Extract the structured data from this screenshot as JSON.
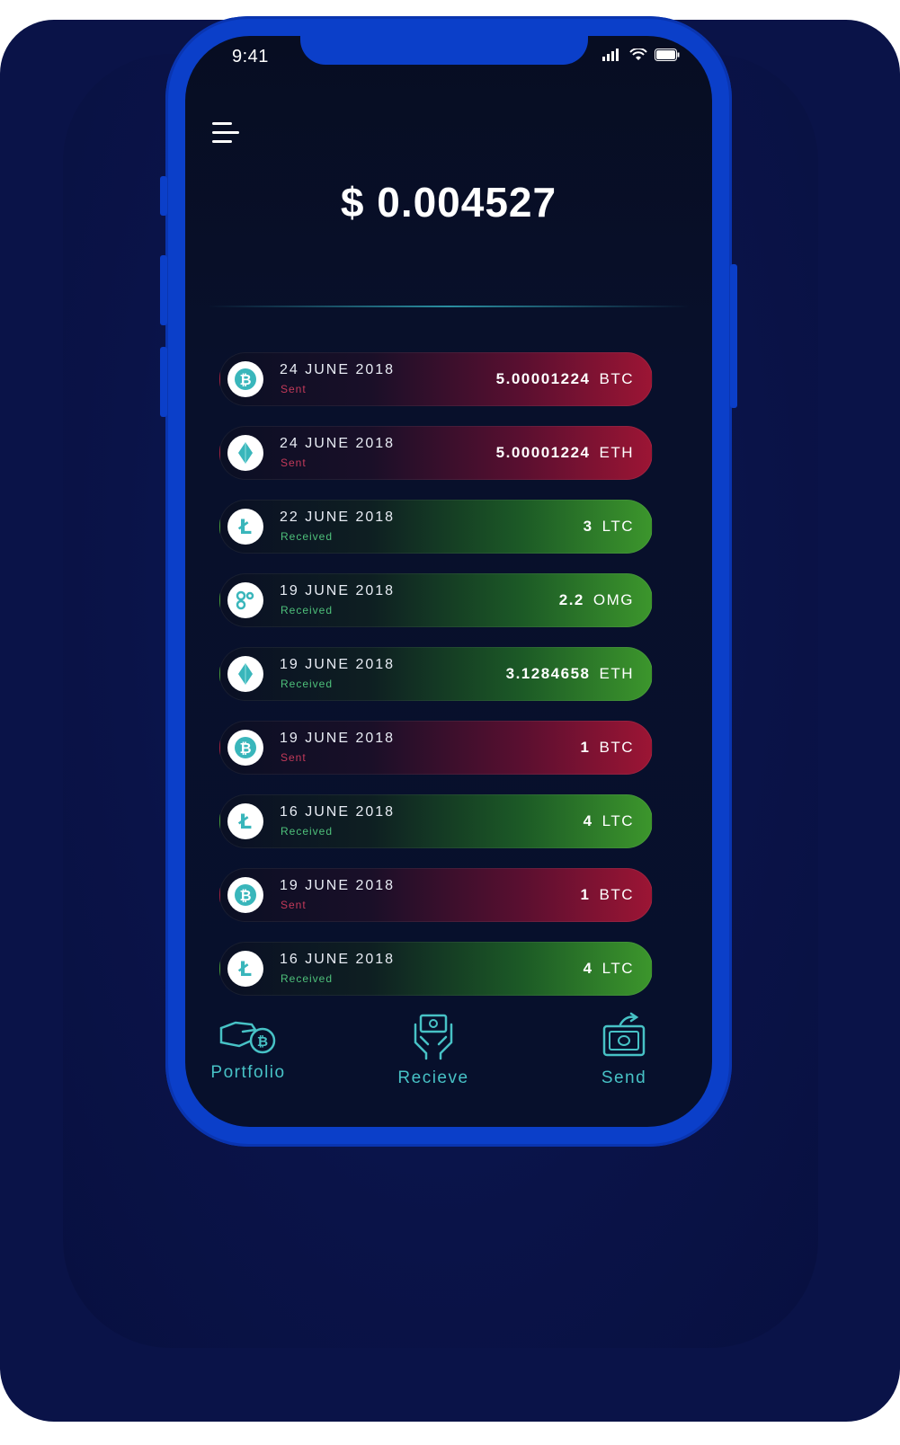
{
  "status_bar": {
    "time": "9:41"
  },
  "balance": "$ 0.004527",
  "transactions": [
    {
      "date": "24 JUNE 2018",
      "status": "Sent",
      "amount": "5.00001224",
      "unit": "BTC",
      "coin_icon": "bitcoin-icon"
    },
    {
      "date": "24 JUNE 2018",
      "status": "Sent",
      "amount": "5.00001224",
      "unit": "ETH",
      "coin_icon": "ethereum-icon"
    },
    {
      "date": "22 JUNE 2018",
      "status": "Received",
      "amount": "3",
      "unit": "LTC",
      "coin_icon": "litecoin-icon"
    },
    {
      "date": "19 JUNE 2018",
      "status": "Received",
      "amount": "2.2",
      "unit": "OMG",
      "coin_icon": "omisego-icon"
    },
    {
      "date": "19 JUNE 2018",
      "status": "Received",
      "amount": "3.1284658",
      "unit": "ETH",
      "coin_icon": "ethereum-icon"
    },
    {
      "date": "19 JUNE 2018",
      "status": "Sent",
      "amount": "1",
      "unit": "BTC",
      "coin_icon": "bitcoin-icon"
    },
    {
      "date": "16 JUNE 2018",
      "status": "Received",
      "amount": "4",
      "unit": "LTC",
      "coin_icon": "litecoin-icon"
    },
    {
      "date": "19 JUNE 2018",
      "status": "Sent",
      "amount": "1",
      "unit": "BTC",
      "coin_icon": "bitcoin-icon"
    },
    {
      "date": "16 JUNE 2018",
      "status": "Received",
      "amount": "4",
      "unit": "LTC",
      "coin_icon": "litecoin-icon"
    }
  ],
  "nav": {
    "portfolio": "Portfolio",
    "receive": "Recieve",
    "send": "Send"
  },
  "colors": {
    "frame": "#0b3fc9",
    "sent": "#9c1534",
    "received": "#3c962c",
    "accent": "#47c2c6"
  }
}
